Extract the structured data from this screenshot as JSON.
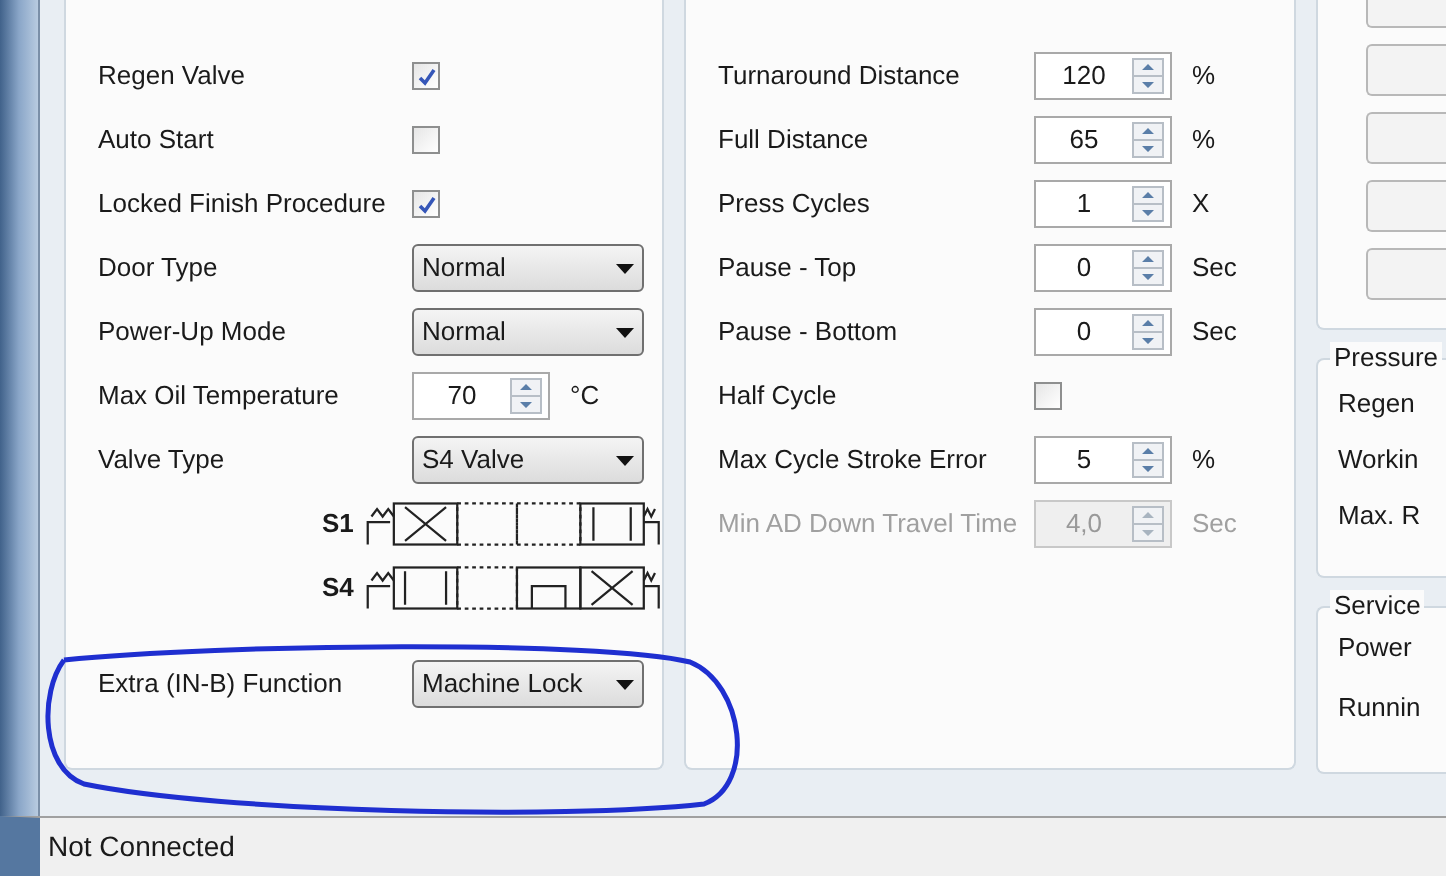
{
  "machine_settings": [
    {
      "kind": "checkbox",
      "label": "Regen Valve",
      "checked": true
    },
    {
      "kind": "checkbox",
      "label": "Auto Start",
      "checked": false
    },
    {
      "kind": "checkbox",
      "label": "Locked Finish Procedure",
      "checked": true
    },
    {
      "kind": "dropdown",
      "label": "Door Type",
      "value": "Normal"
    },
    {
      "kind": "dropdown",
      "label": "Power-Up Mode",
      "value": "Normal"
    },
    {
      "kind": "spinbox",
      "label": "Max Oil Temperature",
      "value": "70",
      "unit": "°C"
    },
    {
      "kind": "dropdown",
      "label": "Valve Type",
      "value": "S4 Valve"
    }
  ],
  "valve_diagrams": [
    {
      "label": "S1"
    },
    {
      "label": "S4"
    }
  ],
  "extra_function": {
    "label": "Extra (IN-B) Function",
    "value": "Machine Lock"
  },
  "cycle_settings": [
    {
      "kind": "spinbox",
      "label": "Turnaround Distance",
      "value": "120",
      "unit": "%",
      "disabled": false
    },
    {
      "kind": "spinbox",
      "label": "Full Distance",
      "value": "65",
      "unit": "%",
      "disabled": false
    },
    {
      "kind": "spinbox",
      "label": "Press Cycles",
      "value": "1",
      "unit": "X",
      "disabled": false
    },
    {
      "kind": "spinbox",
      "label": "Pause - Top",
      "value": "0",
      "unit": "Sec",
      "disabled": false
    },
    {
      "kind": "spinbox",
      "label": "Pause - Bottom",
      "value": "0",
      "unit": "Sec",
      "disabled": false
    },
    {
      "kind": "checkbox",
      "label": "Half Cycle",
      "checked": false,
      "disabled": false
    },
    {
      "kind": "spinbox",
      "label": "Max Cycle Stroke Error",
      "value": "5",
      "unit": "%",
      "disabled": false
    },
    {
      "kind": "spinbox",
      "label": "Min AD Down Travel Time",
      "value": "4,0",
      "unit": "Sec",
      "disabled": true
    }
  ],
  "pressure_group": {
    "title": "Pressure",
    "items": [
      "Regen",
      "Workin",
      "Max. R"
    ]
  },
  "service_group": {
    "title": "Service",
    "items": [
      "Power",
      "Runnin"
    ]
  },
  "status_bar": {
    "text": "Not Connected"
  }
}
